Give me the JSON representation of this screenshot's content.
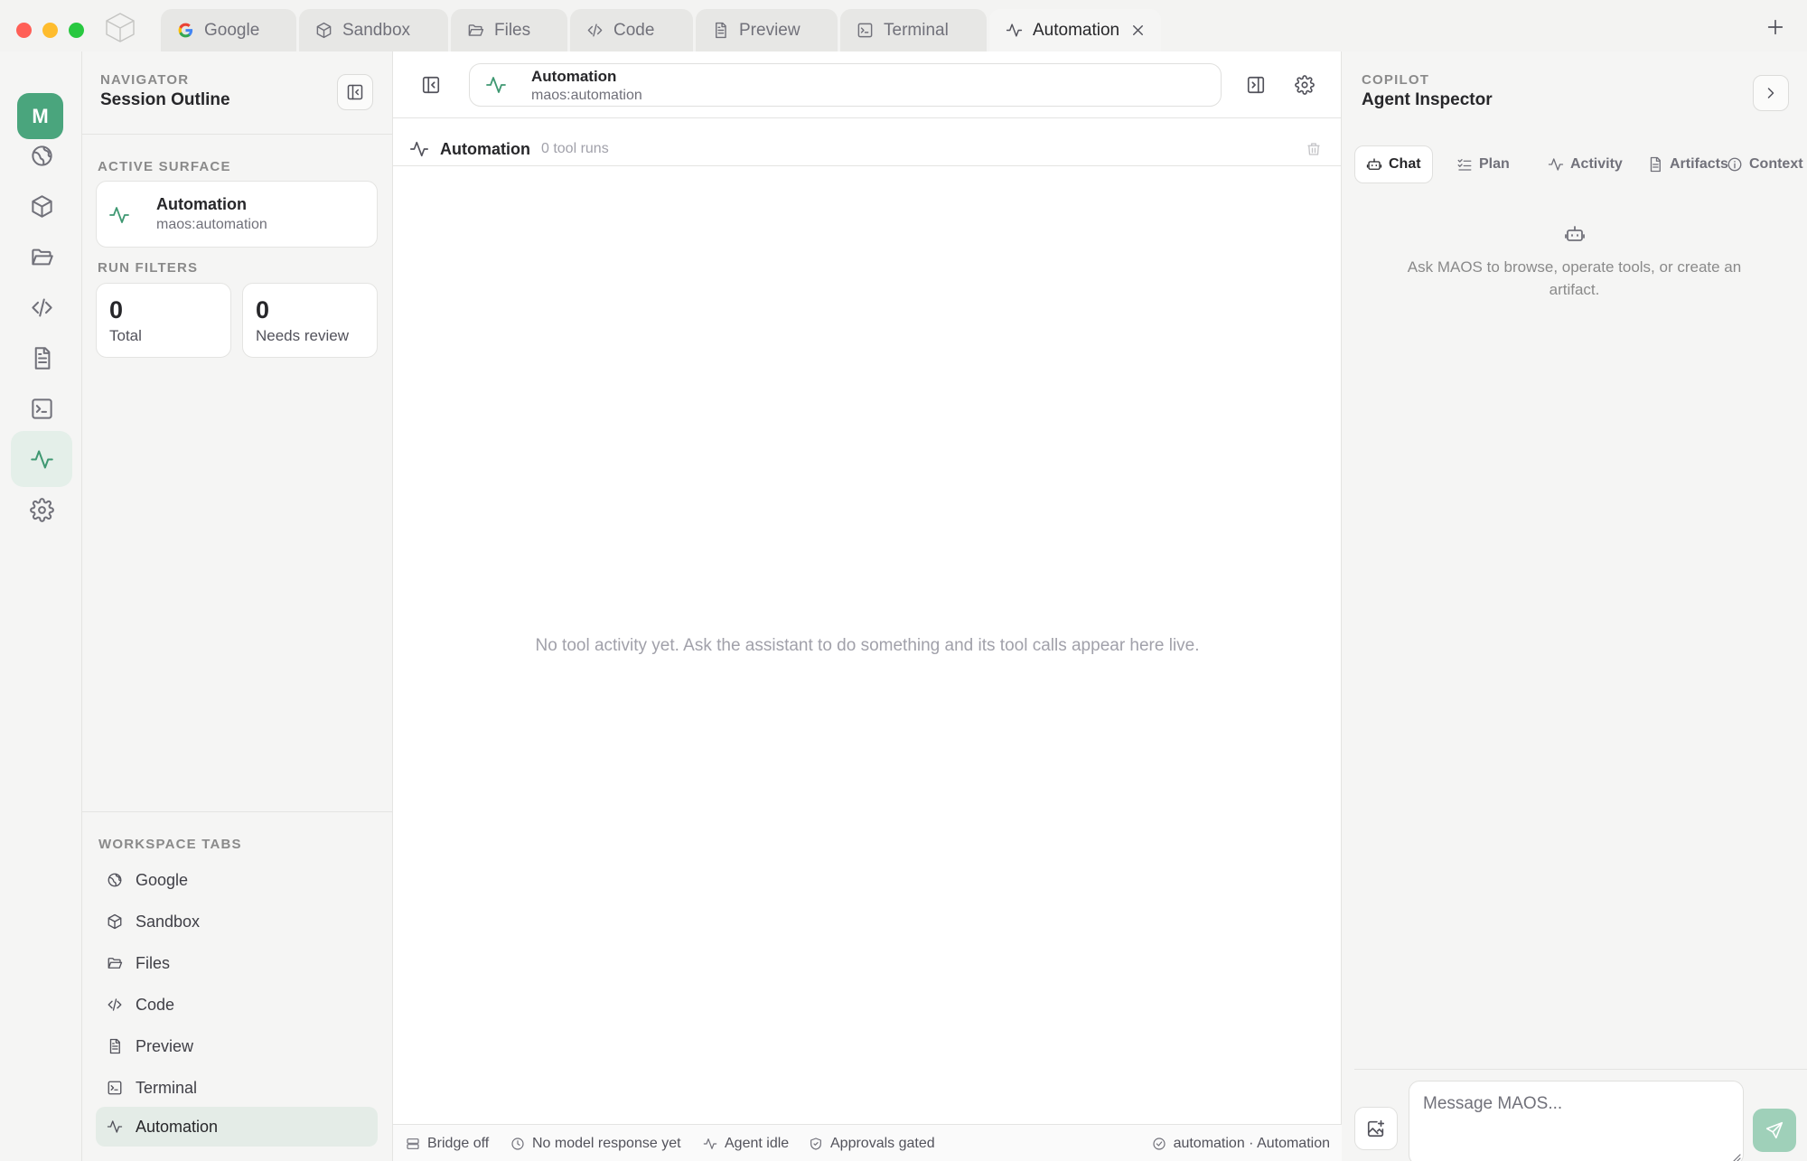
{
  "colors": {
    "accent": "#4aa57d",
    "accent_soft": "#e4efe9",
    "traffic_red": "#ff5f57",
    "traffic_yellow": "#febc2e",
    "traffic_green": "#28c840",
    "send_button": "#9fd0b9"
  },
  "tabs": [
    {
      "label": "Google",
      "icon": "google-icon"
    },
    {
      "label": "Sandbox",
      "icon": "cube-icon"
    },
    {
      "label": "Files",
      "icon": "folder-icon"
    },
    {
      "label": "Code",
      "icon": "code-icon"
    },
    {
      "label": "Preview",
      "icon": "document-icon"
    },
    {
      "label": "Terminal",
      "icon": "terminal-icon"
    },
    {
      "label": "Automation",
      "icon": "activity-icon",
      "active": true
    }
  ],
  "rail": {
    "avatar": "M",
    "items": [
      "globe-icon",
      "cube-icon",
      "folder-icon",
      "code-icon",
      "document-icon",
      "terminal-icon",
      "activity-icon",
      "gear-icon"
    ],
    "active": "activity-icon"
  },
  "navigator": {
    "eyebrow": "NAVIGATOR",
    "title": "Session Outline",
    "active_surface_label": "ACTIVE SURFACE",
    "active_surface": {
      "title": "Automation",
      "subtitle": "maos:automation"
    },
    "run_filters_label": "RUN FILTERS",
    "stats": [
      {
        "value": "0",
        "label": "Total"
      },
      {
        "value": "0",
        "label": "Needs review"
      }
    ],
    "workspace_tabs_label": "WORKSPACE TABS",
    "workspace_tabs": [
      {
        "label": "Google",
        "icon": "globe-icon"
      },
      {
        "label": "Sandbox",
        "icon": "cube-icon"
      },
      {
        "label": "Files",
        "icon": "folder-icon"
      },
      {
        "label": "Code",
        "icon": "code-icon"
      },
      {
        "label": "Preview",
        "icon": "document-icon"
      },
      {
        "label": "Terminal",
        "icon": "terminal-icon"
      },
      {
        "label": "Automation",
        "icon": "activity-icon",
        "active": true
      }
    ]
  },
  "main": {
    "address": {
      "title": "Automation",
      "subtitle": "maos:automation"
    },
    "section_title": "Automation",
    "section_count": "0 tool runs",
    "empty_message": "No tool activity yet. Ask the assistant to do something and its tool calls appear here live.",
    "status": {
      "bridge": "Bridge off",
      "model": "No model response yet",
      "agent": "Agent idle",
      "approvals": "Approvals gated",
      "context": "automation · Automation"
    }
  },
  "copilot": {
    "eyebrow": "COPILOT",
    "title": "Agent Inspector",
    "tabs": [
      {
        "label": "Chat",
        "icon": "robot-icon",
        "active": true
      },
      {
        "label": "Plan",
        "icon": "checklist-icon"
      },
      {
        "label": "Activity",
        "icon": "activity-icon"
      },
      {
        "label": "Artifacts",
        "icon": "document-icon"
      },
      {
        "label": "Context",
        "icon": "info-icon"
      }
    ],
    "empty_text": "Ask MAOS to browse, operate tools, or create an artifact.",
    "input_placeholder": "Message MAOS..."
  }
}
